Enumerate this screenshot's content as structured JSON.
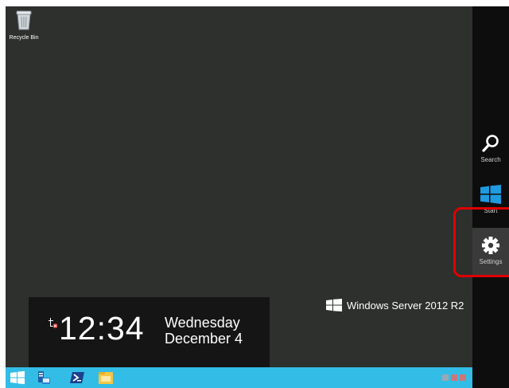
{
  "desktop": {
    "recycle_bin_label": "Recycle Bin"
  },
  "branding": {
    "text": "Windows Server 2012 R2"
  },
  "clock": {
    "time": "12:34",
    "day": "Wednesday",
    "date": "December 4"
  },
  "charms": {
    "search_label": "Search",
    "start_label": "Start",
    "settings_label": "Settings"
  },
  "colors": {
    "desktop_bg": "#2d302d",
    "taskbar_bg": "#33bde6",
    "charms_bg": "#0d0d0d",
    "windows_blue": "#1f9be0",
    "highlight": "#e00000"
  },
  "icons": [
    "recycle-bin-icon",
    "windows-logo-icon",
    "notification-icon",
    "search-icon",
    "start-icon",
    "gear-icon",
    "server-manager-icon",
    "powershell-icon",
    "file-explorer-icon"
  ]
}
